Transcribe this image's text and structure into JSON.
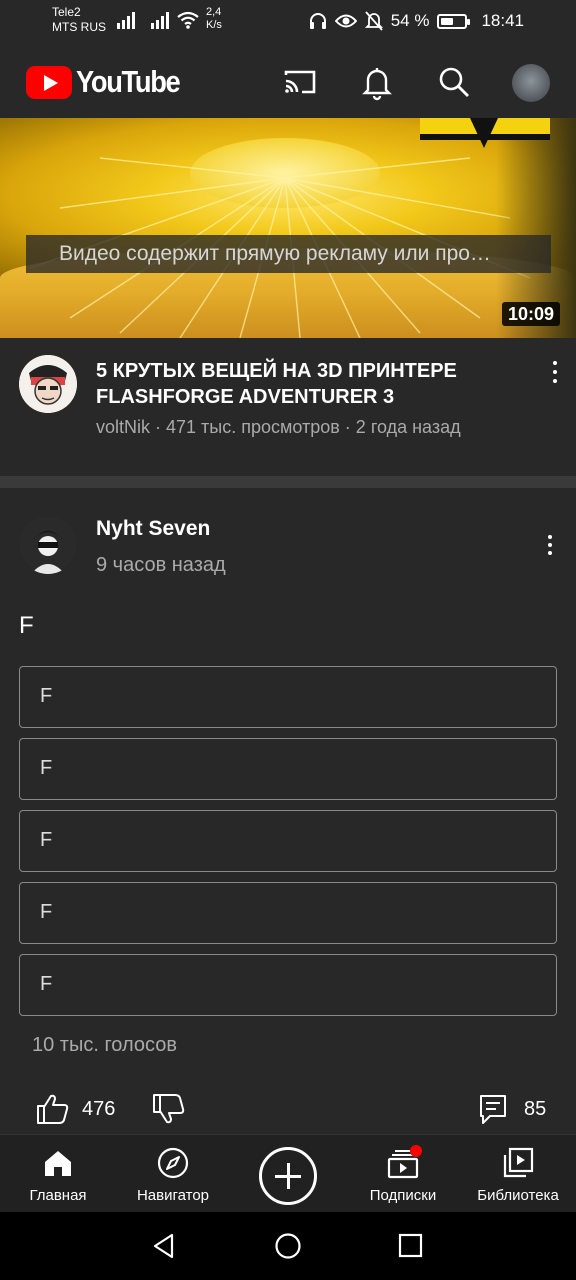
{
  "status_bar": {
    "carrier_line1": "Tele2",
    "carrier_line2": "MTS RUS",
    "rate_value": "2,4",
    "rate_unit": "K/s",
    "battery_percent": "54 %",
    "battery_level": 0.54,
    "time": "18:41"
  },
  "app_bar": {
    "logo_text": "YouTube",
    "icons": [
      "cast-icon",
      "bell-icon",
      "search-icon",
      "account-avatar"
    ]
  },
  "video": {
    "caption": "Видео содержит прямую рекламу или про…",
    "duration": "10:09",
    "title": "5 КРУТЫХ ВЕЩЕЙ НА 3D ПРИНТЕРЕ FLASHFORGE ADVENTURER 3",
    "meta": "voltNik · 471 тыс. просмотров · 2 года назад",
    "channel_avatar_text": "voltNik"
  },
  "post": {
    "author": "Nyht Seven",
    "time": "9 часов назад",
    "text": "F",
    "poll_options": [
      "F",
      "F",
      "F",
      "F",
      "F"
    ],
    "votes": "10 тыс. голосов",
    "likes": "476",
    "comments": "85"
  },
  "bottom_nav": {
    "items": [
      {
        "label": "Главная",
        "icon": "home-icon"
      },
      {
        "label": "Навигатор",
        "icon": "compass-icon"
      },
      {
        "label": "",
        "icon": "create-icon"
      },
      {
        "label": "Подписки",
        "icon": "subscriptions-icon"
      },
      {
        "label": "Библиотека",
        "icon": "library-icon"
      }
    ]
  },
  "colors": {
    "background": "#282828",
    "brand_red": "#ff0000",
    "secondary_text": "#aaaaaa"
  }
}
